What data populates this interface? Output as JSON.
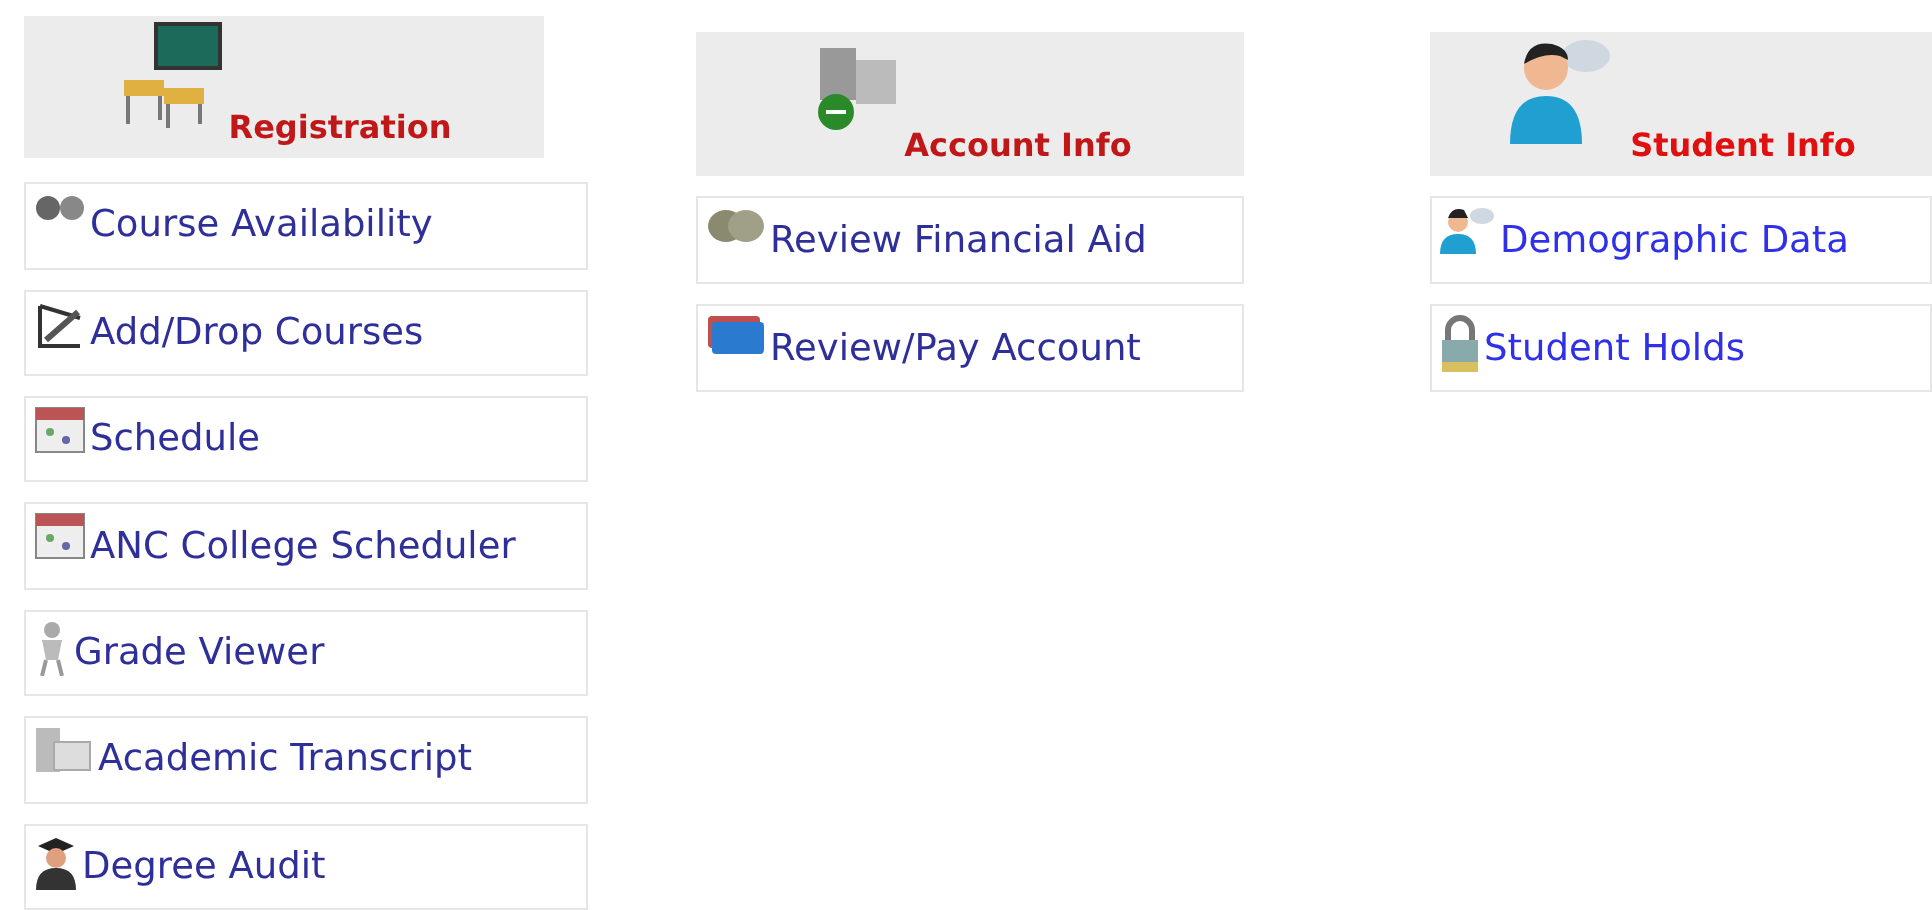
{
  "sections": [
    {
      "title": "Registration",
      "links": [
        {
          "label": "Course Availability"
        },
        {
          "label": "Add/Drop Courses"
        },
        {
          "label": "Schedule"
        },
        {
          "label": "ANC College Scheduler"
        },
        {
          "label": "Grade Viewer"
        },
        {
          "label": "Academic Transcript"
        },
        {
          "label": "Degree Audit"
        }
      ]
    },
    {
      "title": "Account Info",
      "links": [
        {
          "label": "Review Financial Aid"
        },
        {
          "label": "Review/Pay Account"
        }
      ]
    },
    {
      "title": "Student Info",
      "links": [
        {
          "label": "Demographic Data"
        },
        {
          "label": "Student Holds"
        }
      ]
    }
  ]
}
